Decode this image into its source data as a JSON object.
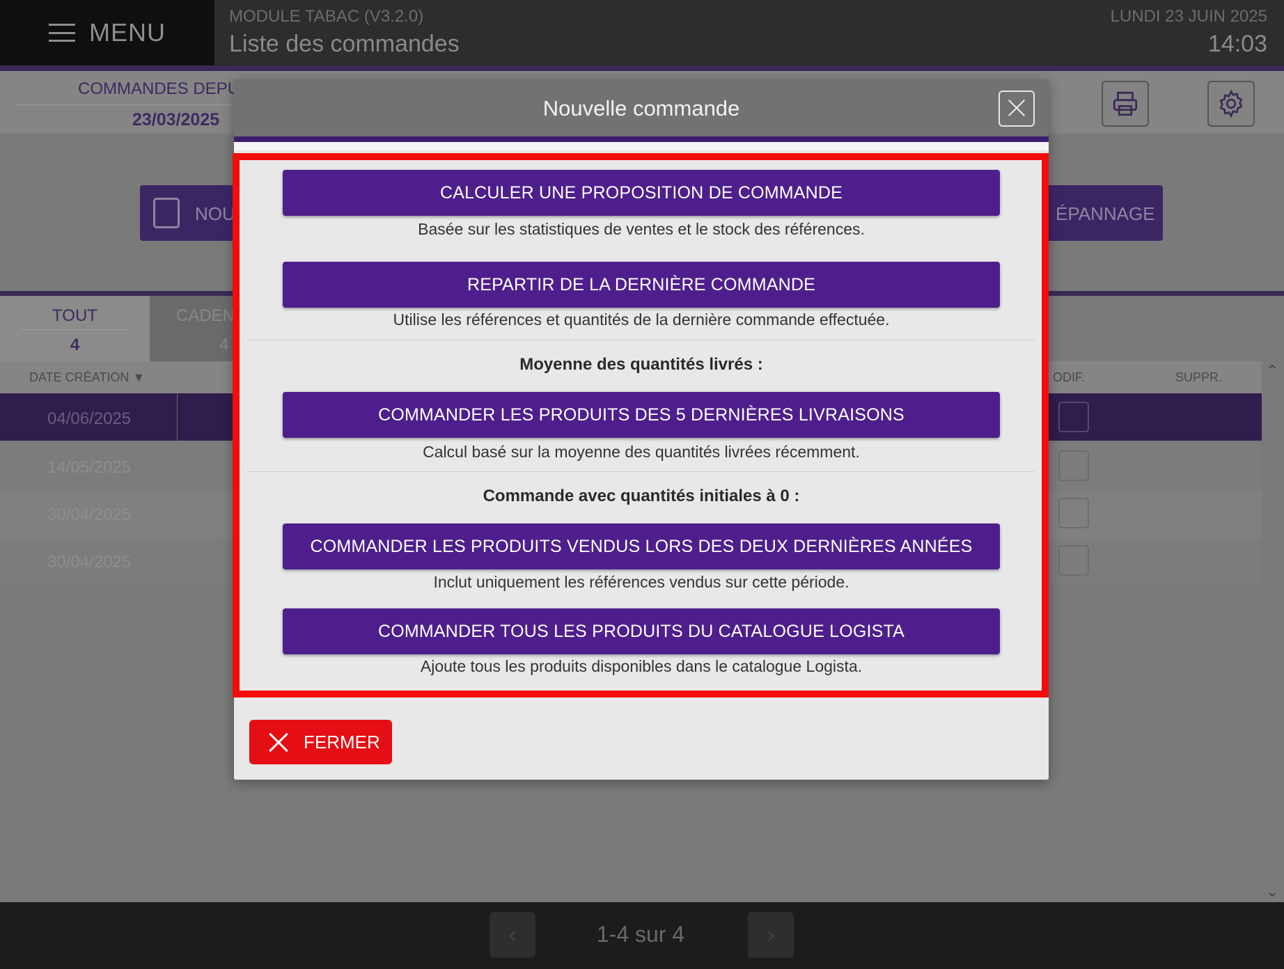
{
  "topbar": {
    "menu_label": "MENU",
    "module": "MODULE TABAC (V3.2.0)",
    "title": "Liste des commandes",
    "date": "LUNDI 23 JUIN 2025",
    "time": "14:03"
  },
  "filter": {
    "title": "COMMANDES DEPU",
    "date": "23/03/2025"
  },
  "actions": {
    "new_order_label": "NOU",
    "depannage_label": "ÉPANNAGE"
  },
  "tabs": [
    {
      "label": "TOUT",
      "count": "4"
    },
    {
      "label": "CADEN",
      "count": "4"
    }
  ],
  "table": {
    "headers": {
      "date": "DATE CRÉATION ▼",
      "modif": "ODIF.",
      "suppr": "SUPPR."
    },
    "rows": [
      {
        "date": "04/06/2025"
      },
      {
        "date": "14/05/2025"
      },
      {
        "date": "30/04/2025"
      },
      {
        "date": "30/04/2025"
      }
    ]
  },
  "pager": {
    "text": "1-4 sur 4",
    "prev": "‹",
    "next": "›"
  },
  "modal": {
    "title": "Nouvelle commande",
    "options": [
      {
        "label": "CALCULER UNE PROPOSITION DE COMMANDE",
        "desc": "Basée sur les statistiques de ventes et le stock des références."
      },
      {
        "label": "REPARTIR DE LA DERNIÈRE COMMANDE",
        "desc": "Utilise les références et quantités de la dernière commande effectuée."
      },
      {
        "label": "COMMANDER LES PRODUITS DES 5 DERNIÈRES LIVRAISONS",
        "desc": "Calcul basé sur la moyenne des quantités livrées récemment."
      },
      {
        "label": "COMMANDER LES PRODUITS VENDUS LORS DES DEUX DERNIÈRES ANNÉES",
        "desc": "Inclut uniquement les références vendus sur cette période."
      },
      {
        "label": "COMMANDER TOUS LES PRODUITS DU CATALOGUE LOGISTA",
        "desc": "Ajoute tous les produits disponibles dans le catalogue Logista."
      }
    ],
    "sections": [
      "Moyenne des quantités livrés :",
      "Commande avec quantités initiales à 0 :"
    ],
    "close_label": "FERMER"
  },
  "colors": {
    "accent": "#4e1f8c",
    "danger": "#e50e14",
    "highlight": "#f20d0d"
  }
}
